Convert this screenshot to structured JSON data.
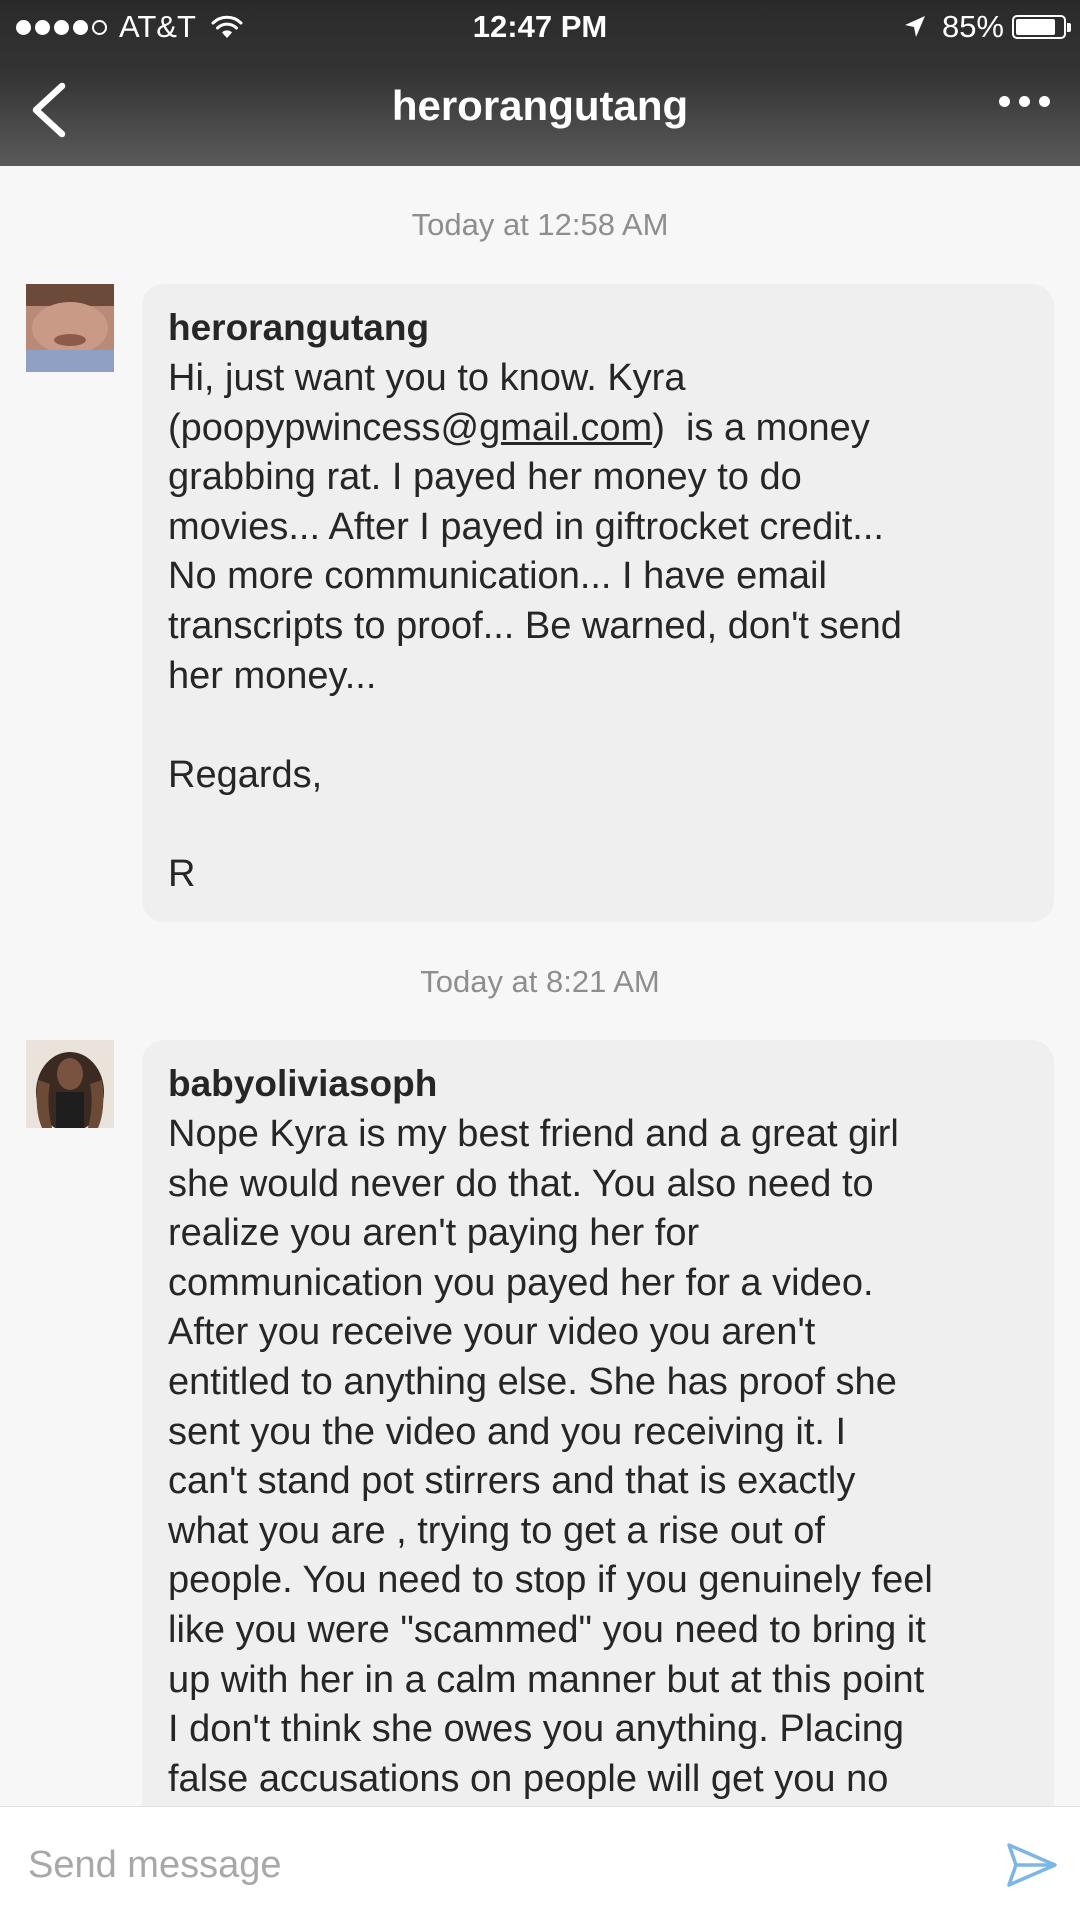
{
  "status_bar": {
    "carrier": "AT&T",
    "time": "12:47 PM",
    "battery": "85%",
    "battery_level": 0.85
  },
  "header": {
    "title": "herorangutang"
  },
  "messages": [
    {
      "timestamp": "Today at 12:58 AM",
      "sender": "herorangutang",
      "text_before_link": "Hi, just want you to know. Kyra\n(poopypwincess@",
      "link": "gmail.com",
      "text_after_link": ")  is a money\ngrabbing rat. I payed her money to do\nmovies... After I payed in giftrocket credit...\nNo more communication... I have email\ntranscripts to proof... Be warned, don't send\nher money...\n\nRegards,\n\nR"
    },
    {
      "timestamp": "Today at 8:21 AM",
      "sender": "babyoliviasoph",
      "text": "Nope Kyra is my best friend and a great girl\nshe would never do that. You also need to\nrealize you aren't paying her for\ncommunication you payed her for a video.\nAfter you receive your video you aren't\nentitled to anything else. She has proof she\nsent you the video and you receiving it. I\ncan't stand pot stirrers and that is exactly\nwhat you are , trying to get a rise out of\npeople. You need to stop if you genuinely feel\nlike you were \"scammed\" you need to bring it\nup with her in a calm manner but at this point\nI don't think she owes you anything. Placing\nfalse accusations on people will get you no"
    }
  ],
  "composer": {
    "placeholder": "Send message"
  },
  "icons": {
    "back": "chevron-left-icon",
    "more": "more-icon",
    "send": "send-icon",
    "wifi": "wifi-icon",
    "location": "location-arrow-icon",
    "battery": "battery-icon"
  },
  "colors": {
    "header_bg": "#343434",
    "bubble_bg": "#efefef",
    "page_bg": "#f7f7f7",
    "send_icon": "#7cb5e6"
  }
}
